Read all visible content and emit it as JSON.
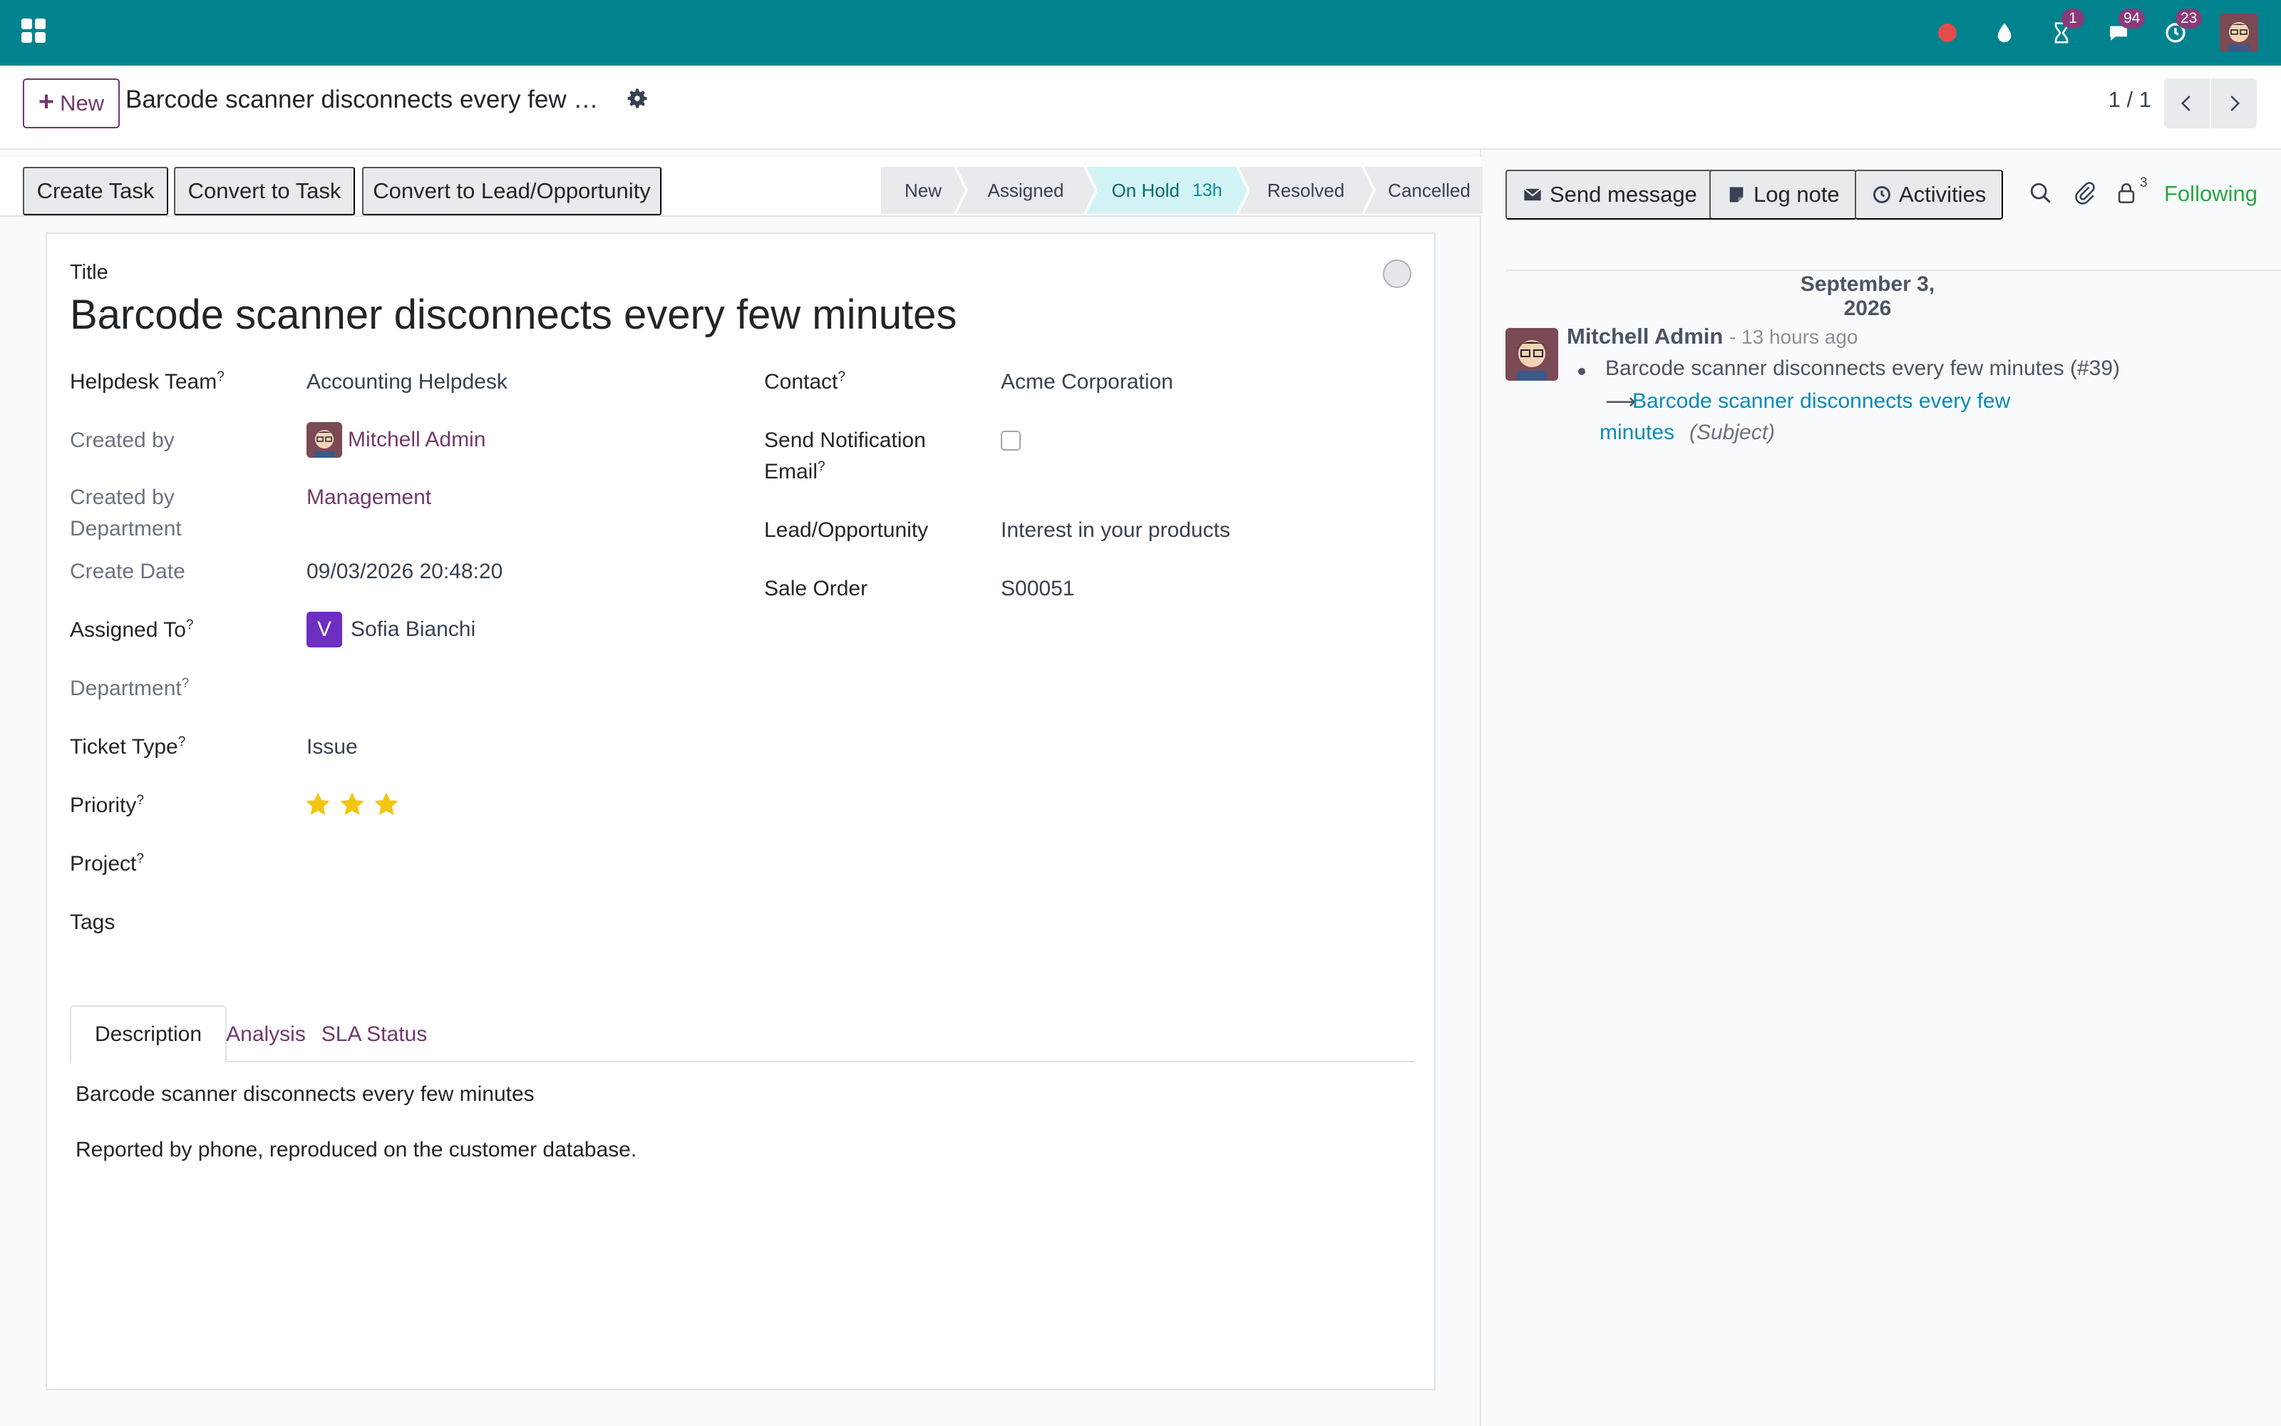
{
  "navbar": {
    "icons": [
      "apps-icon",
      "record-icon",
      "droplet-icon",
      "hourglass-icon",
      "chat-icon",
      "clock-icon",
      "user-avatar"
    ],
    "activity_badge": "1",
    "messages_badge": "94",
    "clock_badge": "23",
    "accent": "#00828f"
  },
  "control_panel": {
    "new_label": "New",
    "breadcrumb": "Barcode scanner disconnects every few …",
    "pager": "1 / 1"
  },
  "statusbar": {
    "buttons": [
      "Create Task",
      "Convert to Task",
      "Convert to Lead/Opportunity"
    ],
    "stages": [
      {
        "label": "New"
      },
      {
        "label": "Assigned"
      },
      {
        "label": "On Hold",
        "duration": "13h",
        "active": true
      },
      {
        "label": "Resolved"
      },
      {
        "label": "Cancelled"
      }
    ]
  },
  "form": {
    "title_label": "Title",
    "title": "Barcode scanner disconnects every few minutes",
    "fields": {
      "helpdesk_team": {
        "label": "Helpdesk Team",
        "help": "?",
        "value": "Accounting Helpdesk"
      },
      "created_by": {
        "label": "Created by",
        "value": "Mitchell Admin"
      },
      "created_by_department": {
        "label_line1": "Created by",
        "label_line2": "Department",
        "value": "Management"
      },
      "create_date": {
        "label": "Create Date",
        "value": "09/03/2026 20:48:20"
      },
      "assigned_to": {
        "label": "Assigned To",
        "help": "?",
        "avatar_letter": "V",
        "value": "Sofia Bianchi"
      },
      "department": {
        "label": "Department",
        "help": "?",
        "value": ""
      },
      "ticket_type": {
        "label": "Ticket Type",
        "help": "?",
        "value": "Issue"
      },
      "priority": {
        "label": "Priority",
        "help": "?",
        "stars": 3,
        "max_stars": 3
      },
      "project": {
        "label": "Project",
        "help": "?",
        "value": ""
      },
      "tags": {
        "label": "Tags",
        "value": ""
      },
      "contact": {
        "label": "Contact",
        "help": "?",
        "value": "Acme Corporation"
      },
      "send_notification": {
        "label_line1": "Send Notification",
        "label_line2": "Email",
        "help": "?",
        "checked": false
      },
      "lead_opportunity": {
        "label": "Lead/Opportunity",
        "value": "Interest in your products"
      },
      "sale_order": {
        "label": "Sale Order",
        "value": "S00051"
      }
    },
    "tabs": [
      {
        "label": "Description",
        "active": true
      },
      {
        "label": "Analysis"
      },
      {
        "label": "SLA Status"
      }
    ],
    "description": [
      "Barcode scanner disconnects every few minutes",
      "Reported by phone, reproduced on the customer database."
    ]
  },
  "chatter": {
    "send_message": "Send message",
    "log_note": "Log note",
    "activities": "Activities",
    "followers_count": "3",
    "following": "Following",
    "date": "September 3, 2026",
    "message": {
      "author": "Mitchell Admin",
      "time": "- 13 hours ago",
      "old_value": "Barcode scanner disconnects every few minutes (#39)",
      "new_value_line1": "Barcode scanner disconnects every few",
      "new_value_line2": "minutes",
      "field": "(Subject)"
    }
  }
}
